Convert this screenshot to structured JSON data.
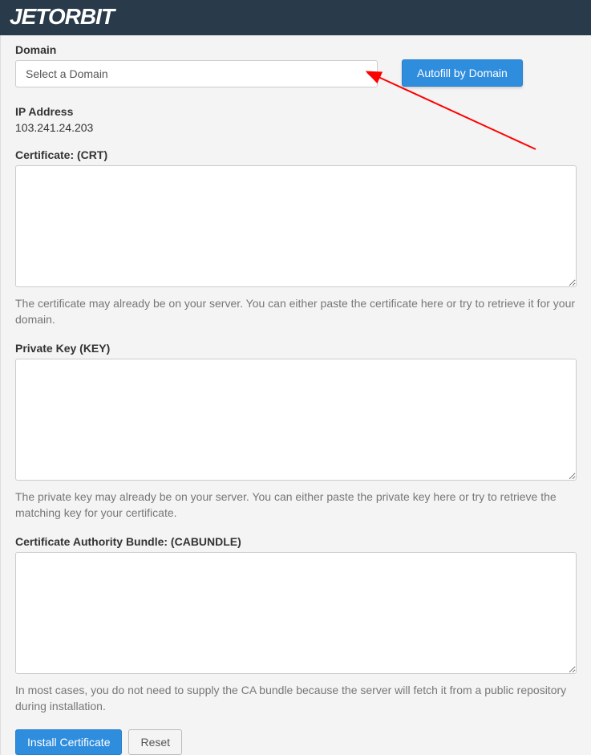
{
  "header": {
    "logo_text": "JETORBIT"
  },
  "form": {
    "domain_label": "Domain",
    "domain_placeholder": "Select a Domain",
    "autofill_button": "Autofill by Domain",
    "ip_address_label": "IP Address",
    "ip_address_value": "103.241.24.203",
    "certificate_label": "Certificate: (CRT)",
    "certificate_help": "The certificate may already be on your server. You can either paste the certificate here or try to retrieve it for your domain.",
    "private_key_label": "Private Key (KEY)",
    "private_key_help": "The private key may already be on your server. You can either paste the private key here or try to retrieve the matching key for your certificate.",
    "cabundle_label": "Certificate Authority Bundle: (CABUNDLE)",
    "cabundle_help": "In most cases, you do not need to supply the CA bundle because the server will fetch it from a public repository during installation.",
    "install_button": "Install Certificate",
    "reset_button": "Reset"
  },
  "colors": {
    "header_bg": "#293a4a",
    "primary_btn": "#2f8dde",
    "arrow": "#ff0000"
  }
}
